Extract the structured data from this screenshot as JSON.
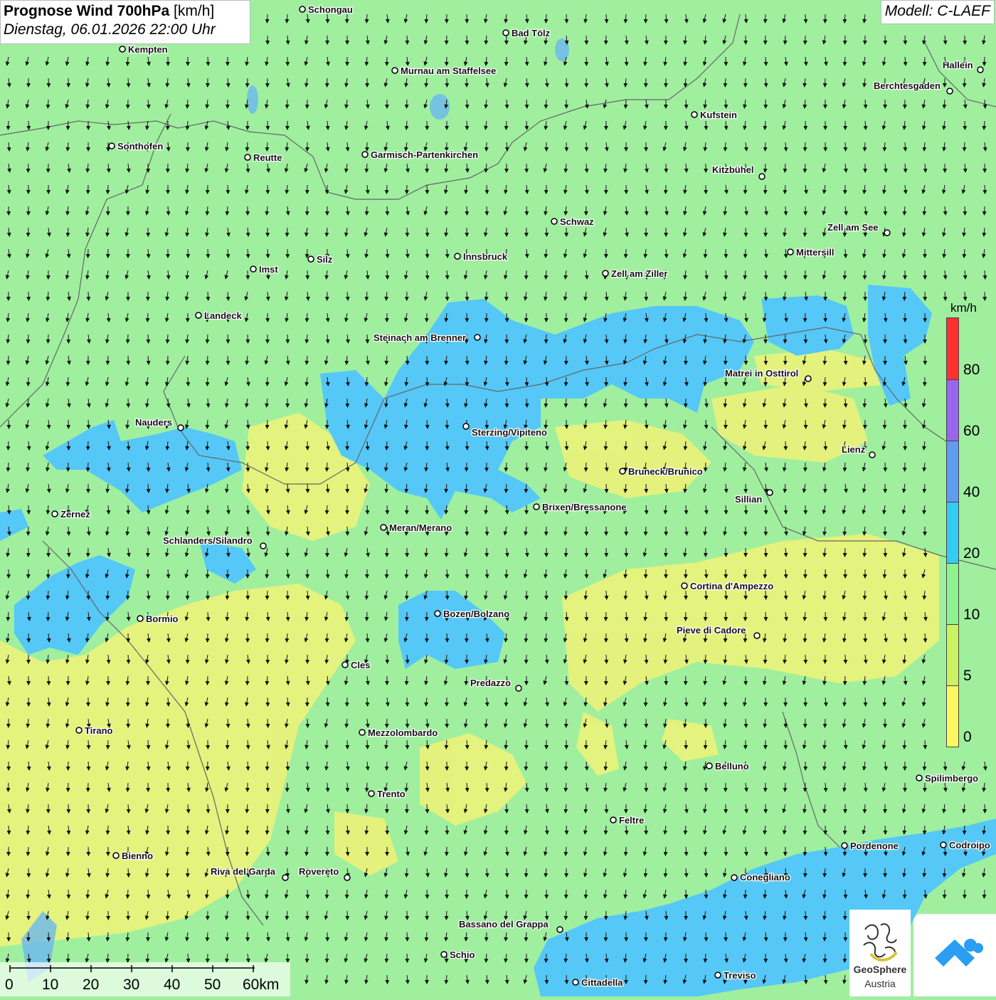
{
  "header": {
    "title_bold": "Prognose Wind 700hPa",
    "title_unit": "[km/h]",
    "datetime": "Dienstag, 06.01.2026 22:00 Uhr",
    "model": "Modell: C-LAEF"
  },
  "legend": {
    "unit": "km/h",
    "ticks": [
      "80",
      "60",
      "40",
      "20",
      "10",
      "5",
      "0"
    ],
    "colors": [
      "#ff3030",
      "#9966ee",
      "#5f9cf2",
      "#33ccf5",
      "#8ef28e",
      "#cbf260",
      "#fff860"
    ]
  },
  "scalebar": {
    "labels": [
      "0",
      "10",
      "20",
      "30",
      "40",
      "50",
      "60km"
    ]
  },
  "logos": {
    "geosphere_line1": "GeoSphere",
    "geosphere_line2": "Austria",
    "geosphere_icon": "geosphere-logo-icon",
    "app_icon": "weather-app-logo-icon"
  },
  "colors": {
    "base_wind": "#9fef9f",
    "strong_wind": "#55c8f8",
    "calm_wind": "#ecf27a",
    "border": "#666666",
    "arrow": "#111111"
  },
  "cities": [
    {
      "name": "Schongau"
    },
    {
      "name": "Bad Tölz"
    },
    {
      "name": "Kempten"
    },
    {
      "name": "Murnau am Staffelsee"
    },
    {
      "name": "Hallein"
    },
    {
      "name": "Berchtesgaden"
    },
    {
      "name": "Kufstein"
    },
    {
      "name": "Sonthofen"
    },
    {
      "name": "Reutte"
    },
    {
      "name": "Garmisch-Partenkirchen"
    },
    {
      "name": "Kitzbühel"
    },
    {
      "name": "Schwaz"
    },
    {
      "name": "Zell am See"
    },
    {
      "name": "Mittersill"
    },
    {
      "name": "Imst"
    },
    {
      "name": "Silz"
    },
    {
      "name": "Innsbruck"
    },
    {
      "name": "Zell am Ziller"
    },
    {
      "name": "Landeck"
    },
    {
      "name": "Steinach am Brenner"
    },
    {
      "name": "Matrei in Osttirol"
    },
    {
      "name": "Nauders"
    },
    {
      "name": "Sterzing/Vipiteno"
    },
    {
      "name": "Lienz"
    },
    {
      "name": "Bruneck/Brunico"
    },
    {
      "name": "Sillian"
    },
    {
      "name": "Zernez"
    },
    {
      "name": "Brixen/Bressanone"
    },
    {
      "name": "Meran/Merano"
    },
    {
      "name": "Schlanders/Silandro"
    },
    {
      "name": "Cortina d'Ampezzo"
    },
    {
      "name": "Bormio"
    },
    {
      "name": "Bozen/Bolzano"
    },
    {
      "name": "Pieve di Cadore"
    },
    {
      "name": "Cles"
    },
    {
      "name": "Predazzo"
    },
    {
      "name": "Tirano"
    },
    {
      "name": "Mezzolombardo"
    },
    {
      "name": "Belluno"
    },
    {
      "name": "Spilimbergo"
    },
    {
      "name": "Trento"
    },
    {
      "name": "Feltre"
    },
    {
      "name": "Pordenone"
    },
    {
      "name": "Codroipo"
    },
    {
      "name": "Bienno"
    },
    {
      "name": "Riva del Garda"
    },
    {
      "name": "Rovereto"
    },
    {
      "name": "Conegliano"
    },
    {
      "name": "Bassano del Grappa"
    },
    {
      "name": "Schio"
    },
    {
      "name": "Treviso"
    },
    {
      "name": "Cittadella"
    }
  ]
}
